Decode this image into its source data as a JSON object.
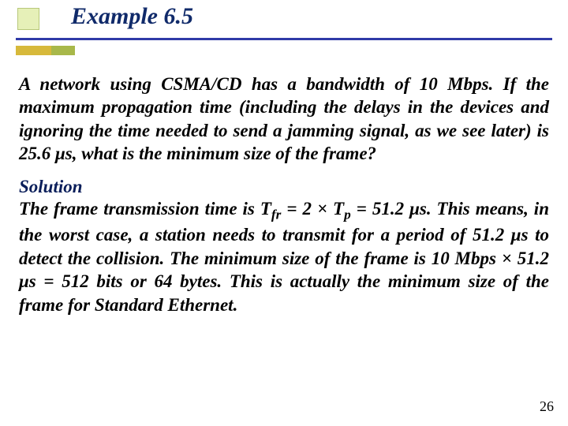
{
  "title": "Example 6.5",
  "problem": "A network using CSMA/CD has a bandwidth of 10 Mbps. If the maximum propagation time (including the delays in the devices and ignoring the time needed to send a jamming signal, as we see later) is 25.6 μs, what is the minimum size of the frame?",
  "solution_label": "Solution",
  "solution_pre": "The frame transmission time is T",
  "solution_sub1": "fr",
  "solution_mid1": " = 2 × T",
  "solution_sub2": "p",
  "solution_post": " = 51.2 μs. This means, in the worst case, a station needs to transmit for a period of 51.2 μs to detect the collision. The minimum size of the frame is 10 Mbps × 51.2 μs = 512 bits or 64 bytes. This is actually the minimum size of the frame for Standard Ethernet.",
  "page_number": "26"
}
